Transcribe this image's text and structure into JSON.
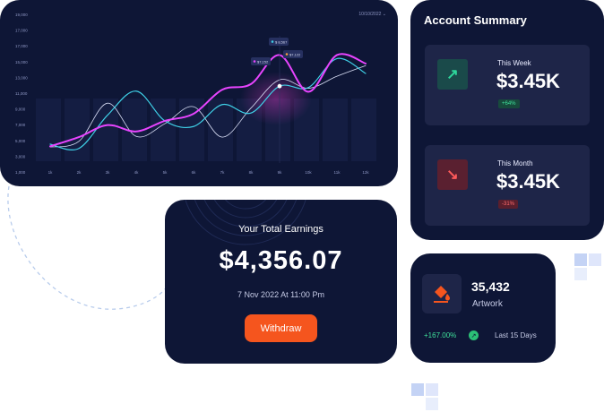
{
  "chart": {
    "date_selector": "10/10/2022",
    "y_ticks": [
      "19,000",
      "17,000",
      "17,000",
      "15,000",
      "13,000",
      "11,000",
      "9,000",
      "7,000",
      "5,000",
      "3,000",
      "1,000"
    ],
    "x_ticks": [
      "1k",
      "2k",
      "3k",
      "4k",
      "5k",
      "6k",
      "7k",
      "8k",
      "9k",
      "10k",
      "11k",
      "12k"
    ],
    "tooltips": [
      "$ 8,567",
      "$7,122",
      "$7,152"
    ],
    "colors": {
      "pink": "#e844ff",
      "cyan": "#3fd1e8",
      "white": "#d9def5"
    }
  },
  "chart_data": {
    "type": "line",
    "x": [
      1,
      2,
      3,
      4,
      5,
      6,
      7,
      8,
      9,
      10,
      11,
      12
    ],
    "ylim": [
      0,
      20000
    ],
    "series": [
      {
        "values": [
          1600,
          2900,
          4600,
          3700,
          5200,
          6200,
          9600,
          10400,
          14500,
          9300,
          14500,
          13300
        ]
      },
      {
        "values": [
          1900,
          1300,
          6000,
          9400,
          5200,
          4400,
          7500,
          6300,
          10100,
          9900,
          14000,
          11900
        ]
      },
      {
        "values": [
          1500,
          2300,
          7700,
          3000,
          4800,
          7200,
          2900,
          7000,
          11000,
          9800,
          11500,
          13000
        ]
      }
    ]
  },
  "summary": {
    "title": "Account Summary",
    "week": {
      "label": "This Week",
      "value": "$3.45K",
      "change": "+64%"
    },
    "month": {
      "label": "This Month",
      "value": "$3.45K",
      "change": "-31%"
    }
  },
  "earnings": {
    "title": "Your Total Earnings",
    "value": "$4,356.07",
    "date": "7 Nov 2022 At 11:00 Pm",
    "button": "Withdraw"
  },
  "artwork": {
    "count": "35,432",
    "label": "Artwork",
    "growth": "+167.00%",
    "period": "Last 15 Days"
  }
}
